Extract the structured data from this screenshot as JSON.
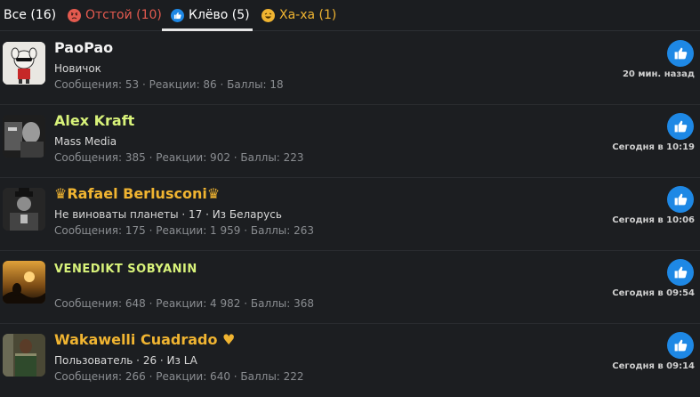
{
  "tabs": [
    {
      "label": "Все (16)",
      "color": "#ffffff",
      "icon": ""
    },
    {
      "label": "Отстой (10)",
      "color": "#e35a4f",
      "icon": "angry-face-icon"
    },
    {
      "label": "Клёво (5)",
      "color": "#ffffff",
      "icon": "like-icon"
    },
    {
      "label": "Ха-ха (1)",
      "color": "#f0b431",
      "icon": "laugh-face-icon"
    }
  ],
  "users": [
    {
      "name": "PaoPao",
      "name_color": "#f2f2f2",
      "subtitle": "Новичок",
      "stats": "Сообщения: 53 · Реакции: 86 · Баллы: 18",
      "time": "20 мин. назад",
      "avatar": "avatar-cartoon"
    },
    {
      "name": "Alex Kraft",
      "name_color": "#d8f27a",
      "subtitle": "Mass Media",
      "stats": "Сообщения: 385 · Реакции: 902 · Баллы: 223",
      "time": "Сегодня в 10:19",
      "avatar": "avatar-bw-photo"
    },
    {
      "name": "♛Rafael Berlusconi♛",
      "name_color": "#f0b431",
      "subtitle": "Не виноваты планеты · 17 · Из Беларусь",
      "stats": "Сообщения: 175 · Реакции: 1 959 · Баллы: 263",
      "time": "Сегодня в 10:06",
      "avatar": "avatar-dark-figure"
    },
    {
      "name": "VENEDIKT SOBYANIN",
      "name_color": "#d8f27a",
      "subtitle": "",
      "stats": "Сообщения: 648 · Реакции: 4 982 · Баллы: 368",
      "time": "Сегодня в 09:54",
      "avatar": "avatar-sunset"
    },
    {
      "name": "Wakawelli Cuadrado ♥",
      "name_color": "#f0b431",
      "subtitle": "Пользователь · 26 · Из LA",
      "stats": "Сообщения: 266 · Реакции: 640 · Баллы: 222",
      "time": "Сегодня в 09:14",
      "avatar": "avatar-street"
    }
  ]
}
